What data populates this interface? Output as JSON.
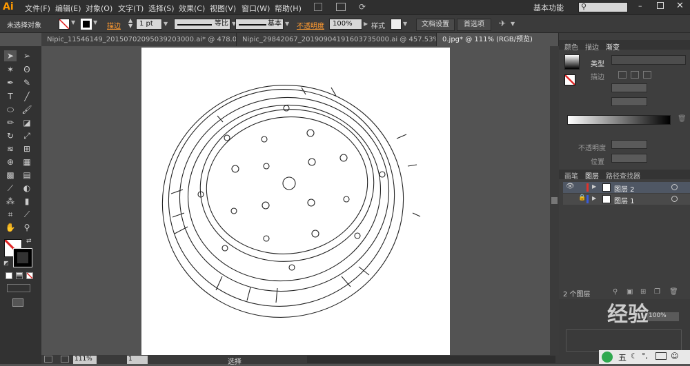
{
  "app": {
    "logo": "Ai"
  },
  "menu": [
    "文件(F)",
    "编辑(E)",
    "对象(O)",
    "文字(T)",
    "选择(S)",
    "效果(C)",
    "视图(V)",
    "窗口(W)",
    "帮助(H)"
  ],
  "workspace": "基本功能",
  "control": {
    "selection": "未选择对象",
    "stroke_label": "描边",
    "stroke_value": "1 pt",
    "profile_1": "等比",
    "profile_2": "基本",
    "opacity_label": "不透明度",
    "opacity_value": "100%",
    "style_label": "样式",
    "doc_settings": "文档设置",
    "prefs": "首选项"
  },
  "tabs": [
    {
      "label": "Nipic_11546149_20150702095039203000.ai* @ 478.09..."
    },
    {
      "label": "Nipic_29842067_20190904191603735000.ai @ 457.53%..."
    },
    {
      "label": "0.jpg* @ 111% (RGB/预览)"
    }
  ],
  "right_panel": {
    "top_tabs": [
      "颜色",
      "描边",
      "渐变"
    ],
    "type_label": "类型",
    "stroke_label": "描边",
    "opacity_label": "不透明度",
    "position_label": "位置",
    "layer_tabs": [
      "画笔",
      "图层",
      "路径查找器"
    ],
    "layers": [
      {
        "name": "图层 2",
        "color": "#e0332b"
      },
      {
        "name": "图层 1",
        "color": "#3a5bd6"
      }
    ],
    "layer_count": "2 个图层",
    "bottom_value": "100%"
  },
  "status": {
    "zoom": "111%",
    "page": "1",
    "mode": "选择"
  },
  "watermark": "经验"
}
